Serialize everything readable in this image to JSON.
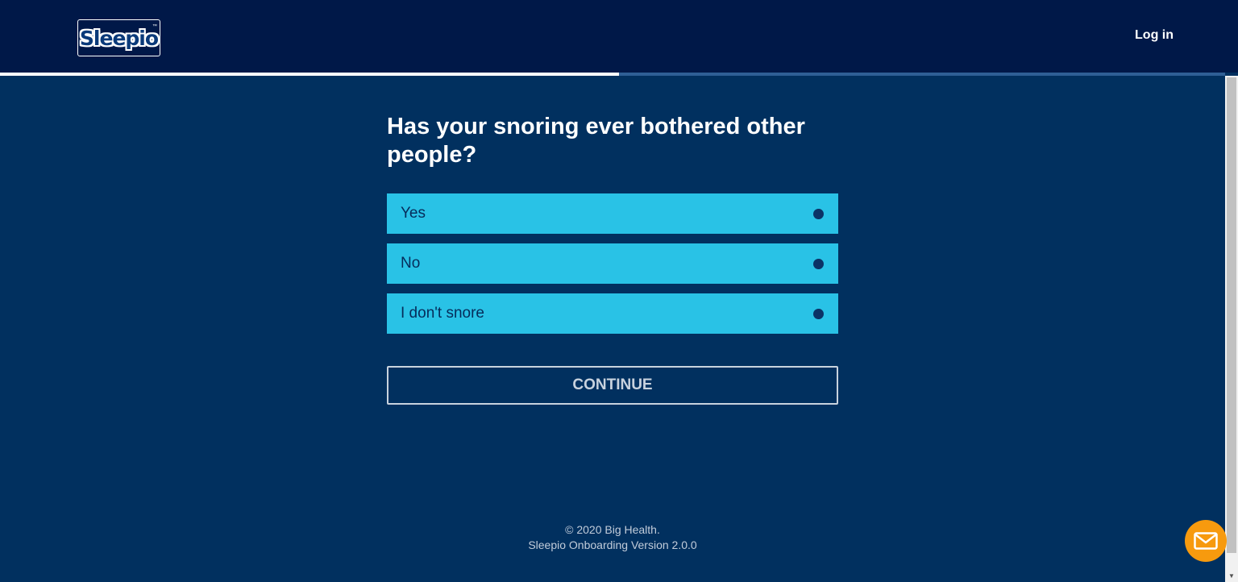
{
  "header": {
    "logo_text": "Sleepio",
    "logo_tm": "™",
    "login_label": "Log in"
  },
  "progress": {
    "fraction": 0.505
  },
  "question": {
    "title": "Has your snoring ever bothered other people?",
    "options": [
      {
        "label": "Yes"
      },
      {
        "label": "No"
      },
      {
        "label": "I don't snore"
      }
    ],
    "continue_label": "CONTINUE"
  },
  "footer": {
    "copyright": "© 2020 Big Health.",
    "version": "Sleepio Onboarding Version 2.0.0"
  },
  "chat": {
    "icon": "mail-icon",
    "color": "#f79a0e"
  },
  "colors": {
    "background": "#01305f",
    "header": "#001848",
    "option": "#29c2e6"
  }
}
